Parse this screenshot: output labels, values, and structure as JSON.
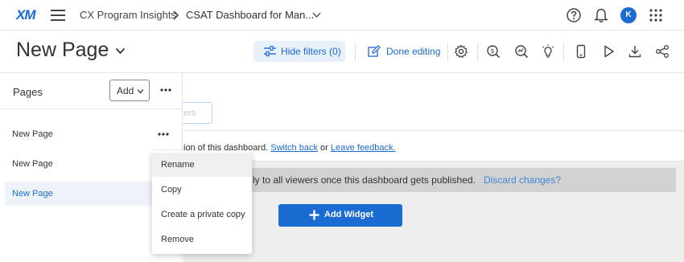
{
  "topbar": {
    "logo": "XM",
    "breadcrumb_project": "CX Program Insights",
    "breadcrumb_dashboard": "CSAT Dashboard for Man...",
    "avatar_initial": "K",
    "icons": [
      "menu-icon",
      "chevron-right-icon",
      "chevron-down-icon",
      "help-icon",
      "bell-icon",
      "apps-grid-icon"
    ]
  },
  "toolbar": {
    "page_title": "New Page",
    "hide_filters_label": "Hide filters (0)",
    "done_editing_label": "Done editing",
    "icons": [
      "gear-icon",
      "search-dollar-icon",
      "search-chart-icon",
      "lightbulb-icon",
      "mobile-icon",
      "play-icon",
      "download-icon",
      "share-icon"
    ]
  },
  "pages_panel": {
    "title": "Pages",
    "add_label": "Add",
    "items": [
      {
        "label": "New Page"
      },
      {
        "label": "New Page"
      },
      {
        "label": "New Page"
      }
    ],
    "active_index": 2
  },
  "main": {
    "filters_stub": "ilters",
    "notice_prefix": "ion of this dashboard. ",
    "switch_back": "Switch back",
    "notice_middle": " or ",
    "leave_feedback": "Leave feedback.",
    "banner_message": "ly to all viewers once this dashboard gets published.",
    "discard_changes": "Discard changes?",
    "add_widget_label": "Add Widget"
  },
  "context_menu": {
    "items": [
      {
        "label": "Rename"
      },
      {
        "label": "Copy"
      },
      {
        "label": "Create a private copy"
      },
      {
        "label": "Remove"
      }
    ],
    "hover_index": 0
  },
  "colors": {
    "accent": "#1a6bd2",
    "link": "#3f85d6",
    "banner_bg": "#d2d2d2",
    "canvas_bg": "#eeeeee"
  }
}
